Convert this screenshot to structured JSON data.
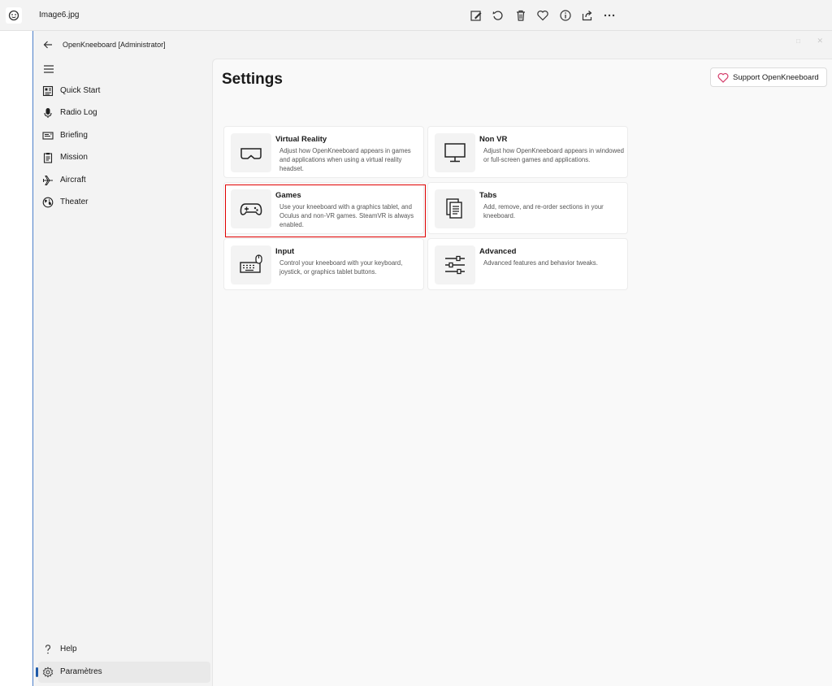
{
  "viewer": {
    "file_name": "Image6.jpg",
    "toolbar": [
      "edit-image-icon",
      "rotate-icon",
      "delete-icon",
      "favorite-icon",
      "info-icon",
      "share-icon",
      "more-icon"
    ]
  },
  "app": {
    "title": "OpenKneeboard [Administrator]"
  },
  "sidebar": {
    "items": [
      {
        "label": "Quick Start",
        "icon": "quick-start-icon"
      },
      {
        "label": "Radio Log",
        "icon": "microphone-icon"
      },
      {
        "label": "Briefing",
        "icon": "briefing-icon"
      },
      {
        "label": "Mission",
        "icon": "clipboard-icon"
      },
      {
        "label": "Aircraft",
        "icon": "airplane-icon"
      },
      {
        "label": "Theater",
        "icon": "globe-icon"
      }
    ],
    "footer": [
      {
        "label": "Help",
        "icon": "question-icon"
      },
      {
        "label": "Paramètres",
        "icon": "gear-icon",
        "selected": true
      }
    ]
  },
  "main": {
    "title": "Settings",
    "support_label": "Support OpenKneeboard",
    "cards": [
      {
        "title": "Virtual Reality",
        "desc": "Adjust how OpenKneeboard appears in games and applications when using a virtual reality headset.",
        "icon": "vr-headset-icon"
      },
      {
        "title": "Non VR",
        "desc": "Adjust how OpenKneeboard appears in windowed or full-screen games and applications.",
        "icon": "monitor-icon"
      },
      {
        "title": "Games",
        "desc": "Use your kneeboard with a graphics tablet, and Oculus and non-VR games. SteamVR is always enabled.",
        "icon": "gamepad-icon",
        "highlighted": true
      },
      {
        "title": "Tabs",
        "desc": "Add, remove, and re-order sections in your kneeboard.",
        "icon": "documents-icon"
      },
      {
        "title": "Input",
        "desc": "Control your kneeboard with your keyboard, joystick, or graphics tablet buttons.",
        "icon": "keyboard-mouse-icon"
      },
      {
        "title": "Advanced",
        "desc": "Advanced features and behavior tweaks.",
        "icon": "sliders-icon"
      }
    ]
  },
  "colors": {
    "highlight_border": "#e00000",
    "selection_indicator": "#1f5aa8",
    "heart": "#d43c6a"
  }
}
